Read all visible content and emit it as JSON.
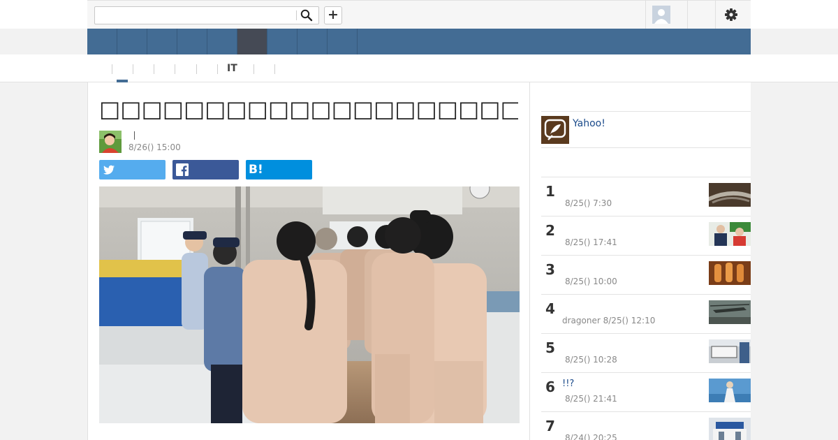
{
  "search": {
    "placeholder": "",
    "value": ""
  },
  "toolbar": {
    "add_label": "+"
  },
  "nav": {
    "items": [
      "",
      "",
      "",
      "",
      "",
      "",
      "",
      "",
      ""
    ],
    "active_index": 5
  },
  "subnav": {
    "items": [
      "",
      "",
      "",
      "",
      "",
      "IT",
      "",
      ""
    ],
    "active_index": 0
  },
  "article": {
    "title": "□□□□□□□□□□□□□□□□□□□□□□□□□□□□□□□",
    "date": "8/26() 15:00"
  },
  "share": {
    "hatena_label": "B!"
  },
  "sidebar": {
    "yahoo_label": "Yahoo!",
    "ranking": [
      {
        "rank": "1",
        "title": "",
        "author": "",
        "date": "8/25() 7:30"
      },
      {
        "rank": "2",
        "title": "",
        "author": "",
        "date": "8/25() 17:41"
      },
      {
        "rank": "3",
        "title": "",
        "author": "",
        "date": "8/25() 10:00"
      },
      {
        "rank": "4",
        "title": "",
        "author": "dragoner",
        "date": "8/25() 12:10"
      },
      {
        "rank": "5",
        "title": "",
        "author": "",
        "date": "8/25() 10:28"
      },
      {
        "rank": "6",
        "title": "!!?",
        "author": "",
        "date": "8/25() 21:41"
      },
      {
        "rank": "7",
        "title": "",
        "author": "",
        "date": "8/24() 20:25"
      }
    ]
  },
  "colors": {
    "nav_blue": "#436c94",
    "nav_active": "#454a55",
    "twitter": "#55acee",
    "facebook": "#3b5998",
    "hatena": "#008fde",
    "link": "#1a4a8a"
  }
}
